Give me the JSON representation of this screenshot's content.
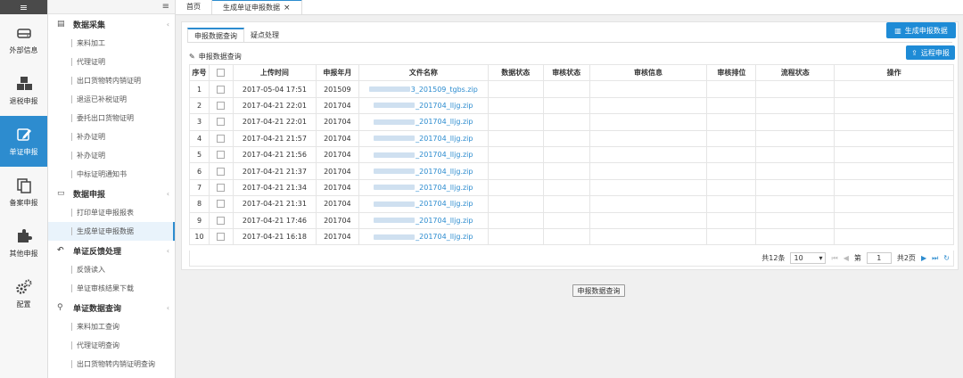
{
  "rail": {
    "top_icon": "≡",
    "items": [
      {
        "label": "外部信息",
        "icon": "drive-icon"
      },
      {
        "label": "退税申报",
        "icon": "boxes-icon"
      },
      {
        "label": "单证申报",
        "icon": "edit-icon"
      },
      {
        "label": "备案申报",
        "icon": "copy-icon"
      },
      {
        "label": "其他申报",
        "icon": "puzzle-icon"
      },
      {
        "label": "配置",
        "icon": "gears-icon"
      }
    ]
  },
  "menu": {
    "toggle": "≡",
    "groups": [
      {
        "label": "数据采集",
        "items": [
          "来料加工",
          "代理证明",
          "出口货物转内销证明",
          "退运已补税证明",
          "委托出口货物证明",
          "补办证明",
          "补办证明",
          "中标证明通知书"
        ]
      },
      {
        "label": "数据申报",
        "items": [
          "打印单证申报报表",
          "生成单证申报数据"
        ]
      },
      {
        "label": "单证反馈处理",
        "items": [
          "反馈读入",
          "单证审核结果下载"
        ]
      },
      {
        "label": "单证数据查询",
        "items": [
          "来料加工查询",
          "代理证明查询",
          "出口货物转内销证明查询"
        ]
      }
    ]
  },
  "tabs": {
    "home": "首页",
    "active": "生成单证申报数据",
    "close": "×"
  },
  "main": {
    "subtabs": [
      "申报数据查询",
      "疑点处理"
    ],
    "gen_button": "生成申报数据",
    "remote_button": "远程申报",
    "section_title": "申报数据查询",
    "columns": [
      "序号",
      "",
      "上传时间",
      "申报年月",
      "文件名称",
      "数据状态",
      "审核状态",
      "审核信息",
      "审核排位",
      "流程状态",
      "操作"
    ],
    "rows": [
      {
        "no": "1",
        "time": "2017-05-04 17:51",
        "ym": "201509",
        "file": "3_201509_tgbs.zip"
      },
      {
        "no": "2",
        "time": "2017-04-21 22:01",
        "ym": "201704",
        "file": "_201704_lljg.zip"
      },
      {
        "no": "3",
        "time": "2017-04-21 22:01",
        "ym": "201704",
        "file": "_201704_lljg.zip"
      },
      {
        "no": "4",
        "time": "2017-04-21 21:57",
        "ym": "201704",
        "file": "_201704_lljg.zip"
      },
      {
        "no": "5",
        "time": "2017-04-21 21:56",
        "ym": "201704",
        "file": "_201704_lljg.zip"
      },
      {
        "no": "6",
        "time": "2017-04-21 21:37",
        "ym": "201704",
        "file": "_201704_lljg.zip"
      },
      {
        "no": "7",
        "time": "2017-04-21 21:34",
        "ym": "201704",
        "file": "_201704_lljg.zip"
      },
      {
        "no": "8",
        "time": "2017-04-21 21:31",
        "ym": "201704",
        "file": "_201704_lljg.zip"
      },
      {
        "no": "9",
        "time": "2017-04-21 17:46",
        "ym": "201704",
        "file": "_201704_lljg.zip"
      },
      {
        "no": "10",
        "time": "2017-04-21 16:18",
        "ym": "201704",
        "file": "_201704_lljg.zip"
      }
    ],
    "pager": {
      "total": "共12条",
      "page_size": "10",
      "page_prefix": "第",
      "page_no": "1",
      "page_total": "共2页"
    }
  },
  "bottom_button": "申报数据查询",
  "colors": {
    "accent": "#2d8ccf",
    "button": "#1e8bd6"
  }
}
